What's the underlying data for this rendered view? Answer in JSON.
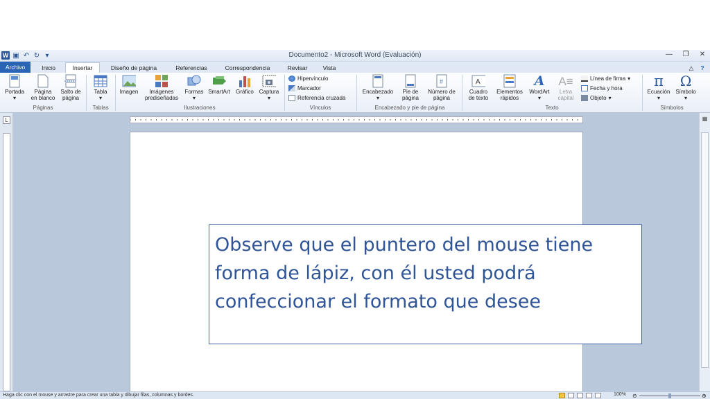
{
  "window": {
    "title": "Documento2 - Microsoft Word (Evaluación)"
  },
  "tabs": [
    "Archivo",
    "Inicio",
    "Insertar",
    "Diseño de página",
    "Referencias",
    "Correspondencia",
    "Revisar",
    "Vista"
  ],
  "ribbon": {
    "paginas": {
      "portada": "Portada",
      "pagina_blanco_1": "Página",
      "pagina_blanco_2": "en blanco",
      "salto_1": "Salto de",
      "salto_2": "página",
      "label": "Páginas"
    },
    "tablas": {
      "tabla": "Tabla",
      "label": "Tablas"
    },
    "ilustraciones": {
      "imagen": "Imagen",
      "imagenes_1": "Imágenes",
      "imagenes_2": "prediseñadas",
      "formas": "Formas",
      "smartart": "SmartArt",
      "grafico": "Gráfico",
      "captura": "Captura",
      "label": "Ilustraciones"
    },
    "vinculos": {
      "hipervinculo": "Hipervínculo",
      "marcador": "Marcador",
      "referencia": "Referencia cruzada",
      "label": "Vínculos"
    },
    "encabezado": {
      "encabezado": "Encabezado",
      "pie_1": "Pie de",
      "pie_2": "página",
      "numero_1": "Número de",
      "numero_2": "página",
      "label": "Encabezado y pie de página"
    },
    "texto": {
      "cuadro_1": "Cuadro",
      "cuadro_2": "de texto",
      "elementos_1": "Elementos",
      "elementos_2": "rápidos",
      "wordart": "WordArt",
      "letra_1": "Letra",
      "letra_2": "capital",
      "linea_firma": "Línea de firma",
      "fecha_hora": "Fecha y hora",
      "objeto": "Objeto",
      "label": "Texto"
    },
    "simbolos": {
      "ecuacion": "Ecuación",
      "simbolo": "Símbolo",
      "label": "Símbolos"
    }
  },
  "status": {
    "text": "Haga clic con el mouse y arrastre para crear una tabla y dibujar filas, columnas y bordes.",
    "zoom": "100%"
  },
  "callout": {
    "text": "Observe que el puntero del mouse tiene forma de lápiz, con él usted podrá confeccionar el formato que desee"
  },
  "colors": {
    "accent": "#2b63b6",
    "callout_text": "#2f5597",
    "workspace": "#b9c8db"
  }
}
